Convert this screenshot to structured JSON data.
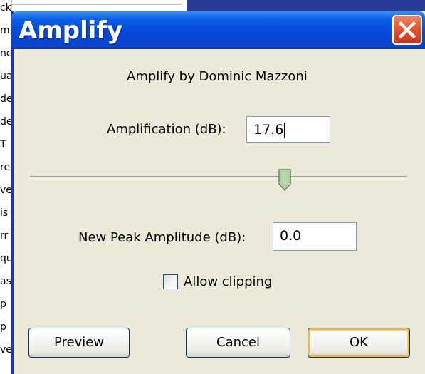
{
  "background": {
    "fragments": [
      "ck",
      "m",
      "nc",
      "ua",
      "de",
      "de",
      "T",
      "re",
      "ve",
      "is",
      "rr",
      "qu",
      "as",
      "p",
      "p",
      "ve"
    ]
  },
  "dialog": {
    "title": "Amplify",
    "plugin_credit": "Amplify by Dominic Mazzoni",
    "amplification": {
      "label": "Amplification (dB):",
      "value": "17.6"
    },
    "slider": {
      "level_fraction": 0.67
    },
    "new_peak": {
      "label": "New Peak Amplitude (dB):",
      "value": "0.0"
    },
    "allow_clipping": {
      "label": "Allow clipping",
      "checked": false
    },
    "buttons": {
      "preview": "Preview",
      "cancel": "Cancel",
      "ok": "OK"
    }
  },
  "colors": {
    "titlebar": "#0548d9",
    "close": "#e3512d",
    "dialog_bg": "#ece9d8",
    "default_button_ring": "#f8b33c"
  },
  "icons": {
    "close": "close-x-icon",
    "slider_thumb": "slider-thumb-icon"
  }
}
